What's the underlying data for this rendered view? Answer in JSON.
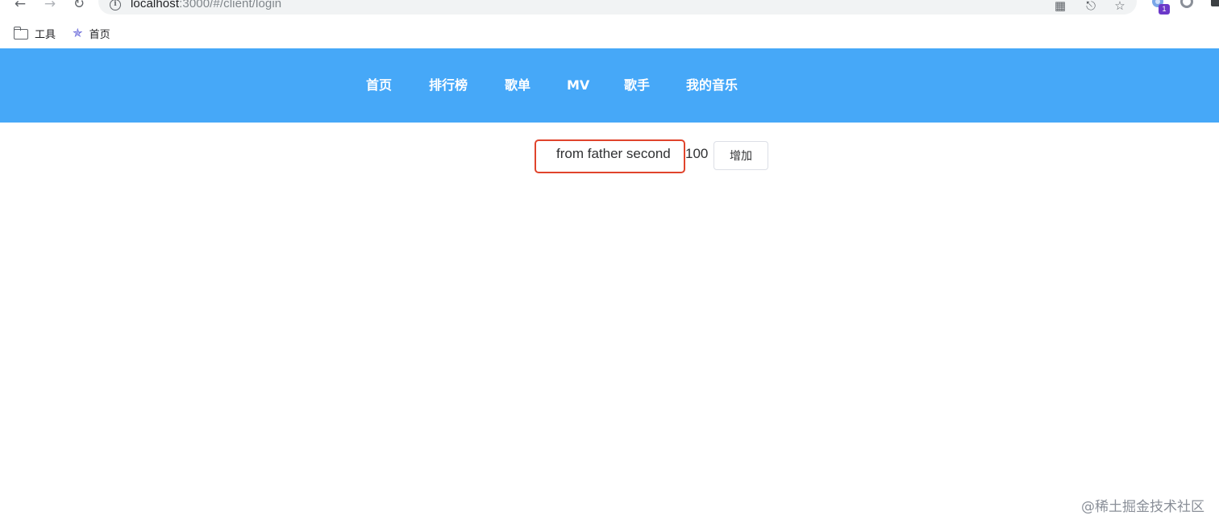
{
  "browser": {
    "url_host": "localhost",
    "url_path": ":3000/#/client/login",
    "extension_badge": "1",
    "bookmarks": [
      {
        "label": "工具",
        "icon": "folder-icon"
      },
      {
        "label": "首页",
        "icon": "star-favicon-icon"
      }
    ]
  },
  "header": {
    "background": "#46a8f8",
    "menu": [
      {
        "label": "首页"
      },
      {
        "label": "排行榜"
      },
      {
        "label": "歌单"
      },
      {
        "label": "MV"
      },
      {
        "label": "歌手"
      },
      {
        "label": "我的音乐"
      }
    ]
  },
  "content": {
    "message": "from father second",
    "count": "100",
    "add_button_label": "增加",
    "highlight_color": "#e0442c"
  },
  "watermark": "@稀土掘金技术社区"
}
